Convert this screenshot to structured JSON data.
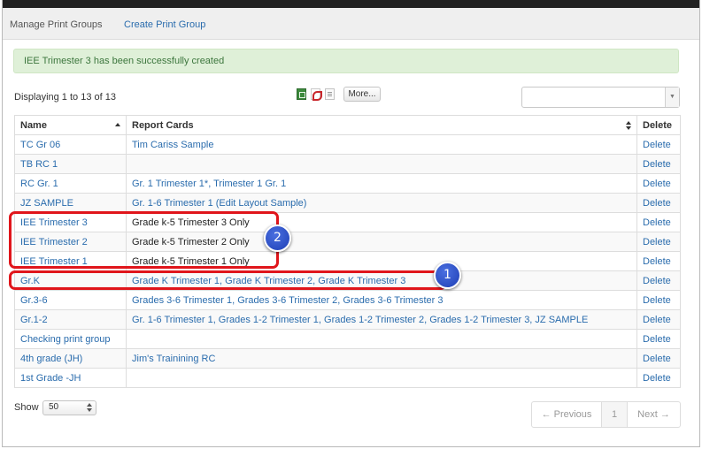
{
  "nav": {
    "manage": "Manage Print Groups",
    "create": "Create Print Group"
  },
  "alert": "IEE Trimester 3 has been successfully created",
  "toolbar": {
    "displaying": "Displaying 1 to 13 of 13",
    "more": "More...",
    "export_icons": [
      "excel-icon",
      "pdf-icon",
      "document-icon"
    ],
    "filter_value": ""
  },
  "table": {
    "headers": {
      "name": "Name",
      "report_cards": "Report Cards",
      "delete": "Delete"
    },
    "rows": [
      {
        "name": "TC Gr 06",
        "report_cards": "Tim Cariss Sample",
        "delete": "Delete"
      },
      {
        "name": "TB RC 1",
        "report_cards": "",
        "delete": "Delete"
      },
      {
        "name": "RC Gr. 1",
        "report_cards": "Gr. 1 Trimester 1*, Trimester 1 Gr. 1",
        "delete": "Delete"
      },
      {
        "name": "JZ SAMPLE",
        "report_cards": "Gr. 1-6 Trimester 1 (Edit Layout Sample)",
        "delete": "Delete"
      },
      {
        "name": "IEE Trimester 3",
        "report_cards": "Grade k-5 Trimester 3 Only",
        "delete": "Delete"
      },
      {
        "name": "IEE Trimester 2",
        "report_cards": "Grade k-5 Trimester 2 Only",
        "delete": "Delete"
      },
      {
        "name": "IEE Trimester 1",
        "report_cards": "Grade k-5 Trimester 1 Only",
        "delete": "Delete"
      },
      {
        "name": "Gr.K",
        "report_cards": "Grade K Trimester 1, Grade K Trimester 2, Grade K Trimester 3",
        "delete": "Delete"
      },
      {
        "name": "Gr.3-6",
        "report_cards": "Grades 3-6 Trimester 1, Grades 3-6 Trimester 2, Grades 3-6 Trimester 3",
        "delete": "Delete"
      },
      {
        "name": "Gr.1-2",
        "report_cards": "Gr. 1-6 Trimester 1, Grades 1-2 Trimester 1, Grades 1-2 Trimester 2, Grades 1-2 Trimester 3, JZ SAMPLE",
        "delete": "Delete"
      },
      {
        "name": "Checking print group",
        "report_cards": "",
        "delete": "Delete"
      },
      {
        "name": "4th grade (JH)",
        "report_cards": "Jim's Trainining RC",
        "delete": "Delete"
      },
      {
        "name": "1st Grade -JH",
        "report_cards": "",
        "delete": "Delete"
      }
    ]
  },
  "callouts": {
    "one": "1",
    "two": "2"
  },
  "colors": {
    "highlight": "#e0151b",
    "callout": "#2a4fcc",
    "link": "#2a6cad",
    "alert_bg": "#dff0d8"
  },
  "footer": {
    "show_label": "Show",
    "page_size": "50",
    "prev": "← Previous",
    "page": "1",
    "next": "Next →"
  }
}
